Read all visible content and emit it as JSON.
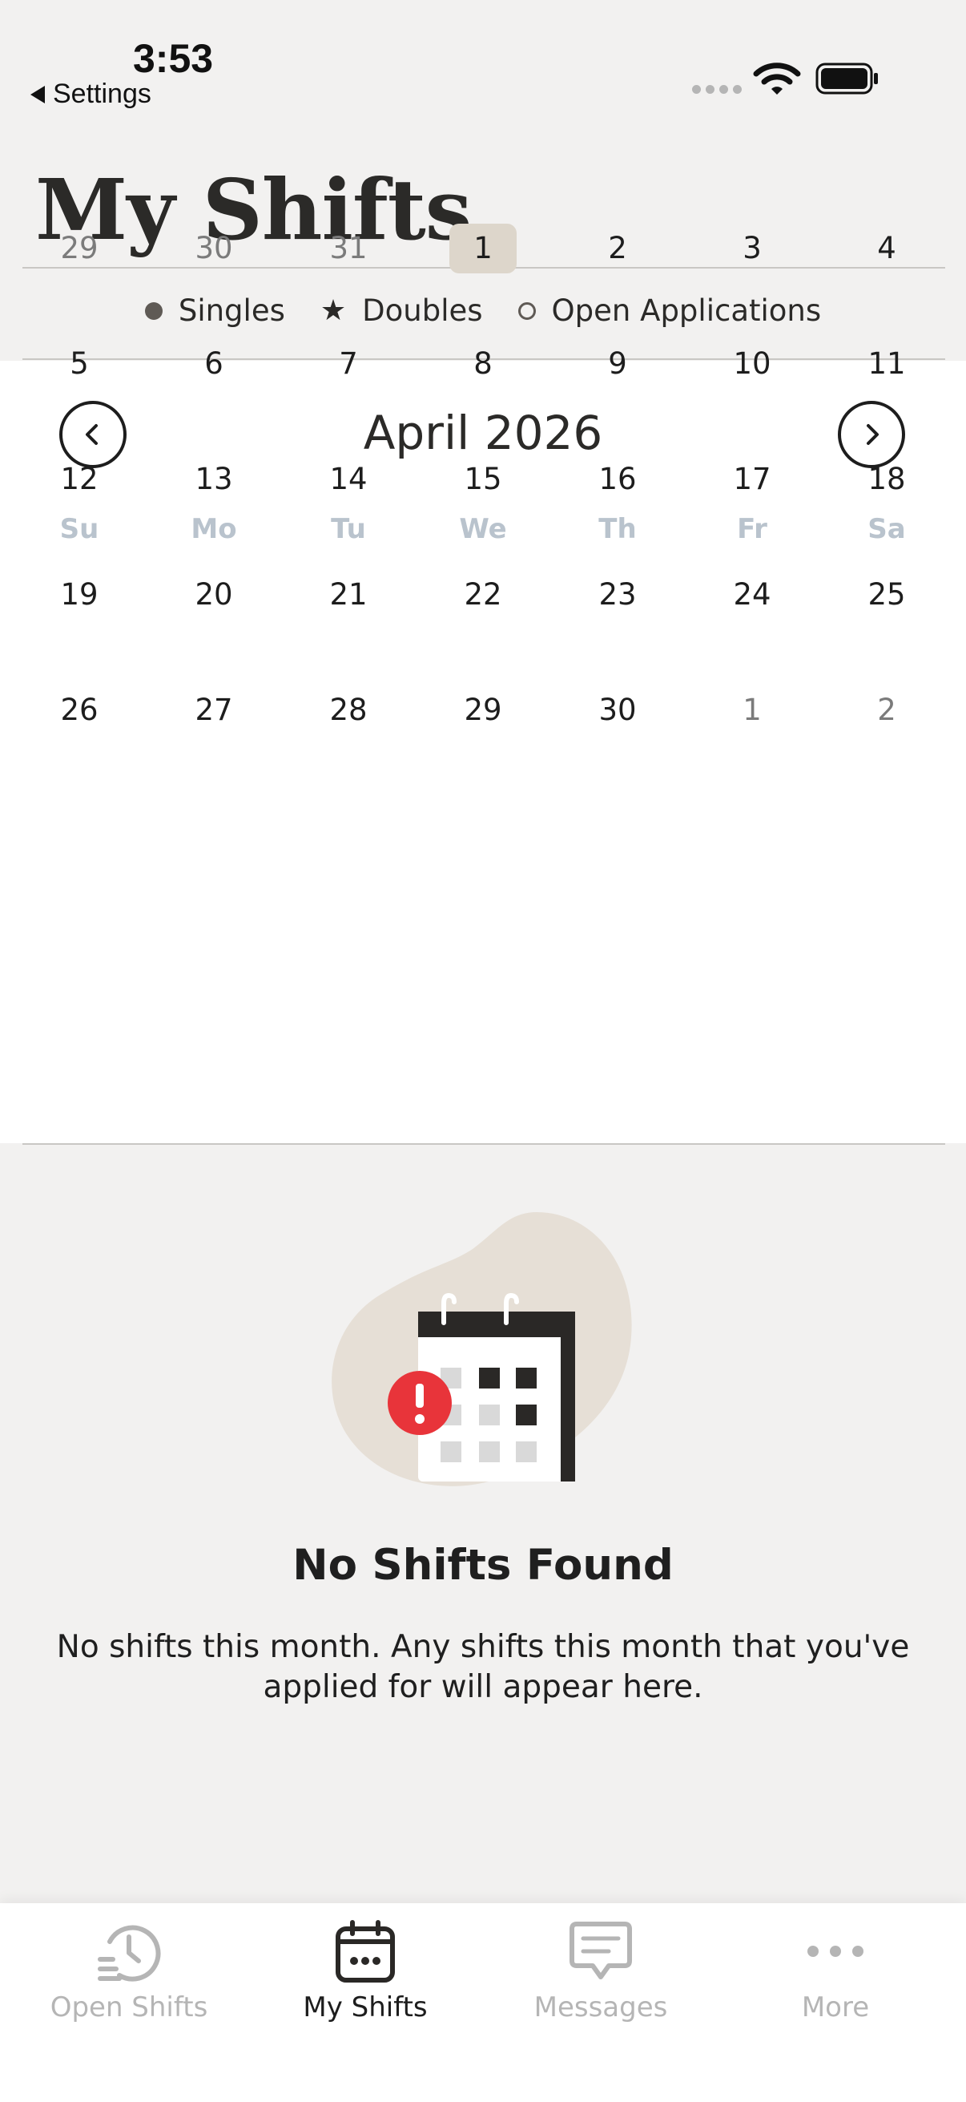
{
  "status_bar": {
    "time": "3:53",
    "back_label": "Settings"
  },
  "header": {
    "title": "My Shifts"
  },
  "legend": [
    {
      "icon": "filled-circle-icon",
      "label": "Singles"
    },
    {
      "icon": "star-icon",
      "label": "Doubles"
    },
    {
      "icon": "open-circle-icon",
      "label": "Open Applications"
    }
  ],
  "calendar": {
    "month_label": "April 2026",
    "weekdays": [
      "Su",
      "Mo",
      "Tu",
      "We",
      "Th",
      "Fr",
      "Sa"
    ],
    "weeks": [
      [
        "29",
        "30",
        "31",
        "1",
        "2",
        "3",
        "4"
      ],
      [
        "5",
        "6",
        "7",
        "8",
        "9",
        "10",
        "11"
      ],
      [
        "12",
        "13",
        "14",
        "15",
        "16",
        "17",
        "18"
      ],
      [
        "19",
        "20",
        "21",
        "22",
        "23",
        "24",
        "25"
      ],
      [
        "26",
        "27",
        "28",
        "29",
        "30",
        "1",
        "2"
      ]
    ],
    "outside_month": [
      [
        0,
        0
      ],
      [
        0,
        1
      ],
      [
        0,
        2
      ],
      [
        4,
        5
      ],
      [
        4,
        6
      ]
    ],
    "selected": [
      0,
      3
    ],
    "selected_color": "#ddd6cb"
  },
  "empty_state": {
    "title": "No Shifts Found",
    "message": "No shifts this month. Any shifts this month that you've applied for will appear here."
  },
  "tabs": [
    {
      "label": "Open Shifts",
      "icon": "clock-history-icon",
      "active": false
    },
    {
      "label": "My Shifts",
      "icon": "calendar-icon",
      "active": true
    },
    {
      "label": "Messages",
      "icon": "message-icon",
      "active": false
    },
    {
      "label": "More",
      "icon": "more-dots-icon",
      "active": false
    }
  ],
  "colors": {
    "background": "#f2f1f0",
    "accent_beige": "#ddd6cb",
    "alert_red": "#e8343a"
  }
}
